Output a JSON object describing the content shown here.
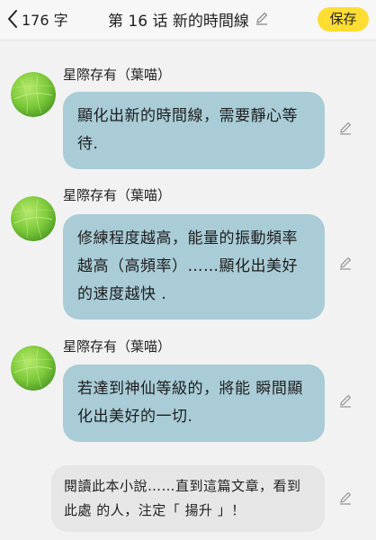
{
  "header": {
    "word_count": "176 字",
    "title": "第 16 话  新的時間線",
    "save_label": "保存"
  },
  "messages": [
    {
      "sender": "星際存有（葉喵）",
      "text": "顯化出新的時間線，需要靜心等待."
    },
    {
      "sender": "星際存有（葉喵）",
      "text": "修練程度越高，能量的振動頻率越高（高頻率）……顯化出美好 的速度越快 ."
    },
    {
      "sender": "星際存有（葉喵）",
      "text": "若達到神仙等級的，將能  瞬間顯化出美好的一切."
    }
  ],
  "narration": {
    "text": "閱讀此本小說……直到這篇文章，看到 此處 的人，注定「 揚升 」！"
  },
  "colors": {
    "accent": "#ffdd33",
    "bubble": "#a9ccd6",
    "narration_bubble": "#e6e6e6",
    "background": "#f2f2f2"
  },
  "icons": {
    "back": "chevron-left-icon",
    "edit": "pencil-icon",
    "avatar": "green-leaf-avatar"
  }
}
